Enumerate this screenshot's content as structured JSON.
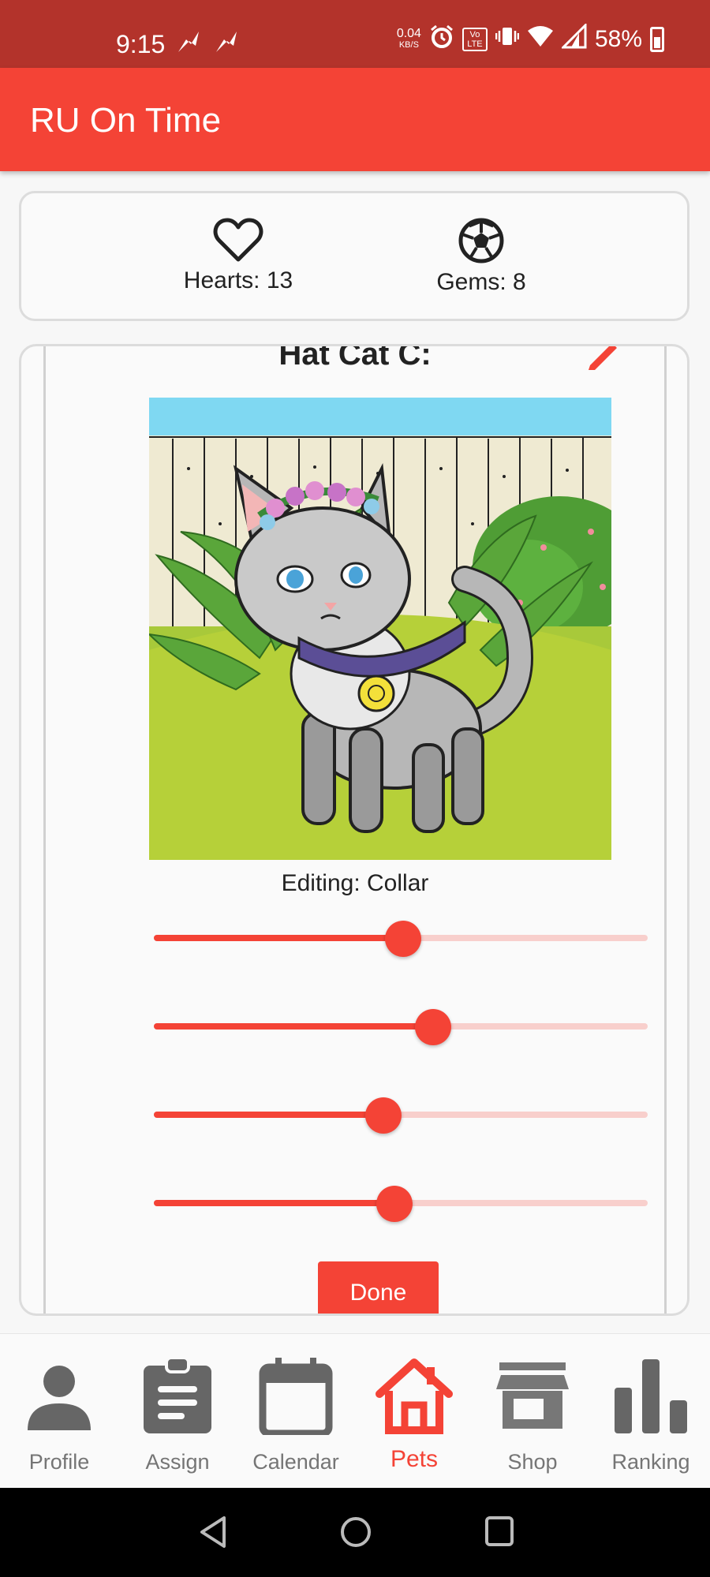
{
  "status_bar": {
    "time": "9:15",
    "net_speed_value": "0.04",
    "net_speed_unit": "KB/S",
    "volte": "Vo LTE",
    "battery": "58%"
  },
  "app_bar": {
    "title": "RU On Time"
  },
  "stats": {
    "hearts_label": "Hearts: 13",
    "gems_label": "Gems: 8"
  },
  "pet": {
    "name": "Hat Cat C:",
    "editing_label": "Editing: Collar",
    "sliders": [
      {
        "name": "collar-slider-1",
        "value": 0.505
      },
      {
        "name": "collar-slider-2",
        "value": 0.565
      },
      {
        "name": "collar-slider-3",
        "value": 0.465
      },
      {
        "name": "collar-slider-4",
        "value": 0.488
      }
    ],
    "done_label": "Done"
  },
  "bottom_nav": {
    "items": [
      {
        "label": "Profile",
        "icon": "person-icon",
        "active": false
      },
      {
        "label": "Assign",
        "icon": "clipboard-icon",
        "active": false
      },
      {
        "label": "Calendar",
        "icon": "calendar-icon",
        "active": false
      },
      {
        "label": "Pets",
        "icon": "house-icon",
        "active": true
      },
      {
        "label": "Shop",
        "icon": "store-icon",
        "active": false
      },
      {
        "label": "Ranking",
        "icon": "bar-chart-icon",
        "active": false
      }
    ]
  },
  "colors": {
    "primary": "#f44336",
    "status_bar": "#b3332b",
    "slider_track": "#f8cfcc",
    "nav_inactive": "#757575"
  }
}
